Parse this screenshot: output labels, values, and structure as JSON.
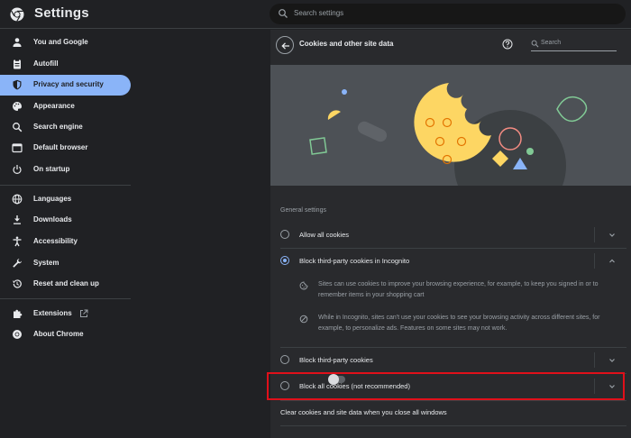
{
  "header": {
    "app_title": "Settings",
    "search_placeholder": "Search settings"
  },
  "sidebar": {
    "items": [
      {
        "label": "You and Google",
        "icon": "person-icon",
        "active": false
      },
      {
        "label": "Autofill",
        "icon": "clipboard-icon",
        "active": false
      },
      {
        "label": "Privacy and security",
        "icon": "shield-icon",
        "active": true
      },
      {
        "label": "Appearance",
        "icon": "palette-icon",
        "active": false
      },
      {
        "label": "Search engine",
        "icon": "search-icon",
        "active": false
      },
      {
        "label": "Default browser",
        "icon": "browser-window-icon",
        "active": false
      },
      {
        "label": "On startup",
        "icon": "power-icon",
        "active": false
      },
      {
        "label": "Languages",
        "icon": "globe-icon",
        "active": false
      },
      {
        "label": "Downloads",
        "icon": "download-icon",
        "active": false
      },
      {
        "label": "Accessibility",
        "icon": "accessibility-icon",
        "active": false
      },
      {
        "label": "System",
        "icon": "wrench-icon",
        "active": false
      },
      {
        "label": "Reset and clean up",
        "icon": "restore-icon",
        "active": false
      },
      {
        "label": "Extensions",
        "icon": "puzzle-icon",
        "active": false
      },
      {
        "label": "About Chrome",
        "icon": "chrome-icon",
        "active": false
      }
    ]
  },
  "panel": {
    "title": "Cookies and other site data",
    "search_placeholder": "Search",
    "section_label": "General settings",
    "options": [
      {
        "label": "Allow all cookies",
        "checked": false,
        "expanded": false
      },
      {
        "label": "Block third-party cookies in Incognito",
        "checked": true,
        "expanded": true
      },
      {
        "label": "Block third-party cookies",
        "checked": false,
        "expanded": false
      },
      {
        "label": "Block all cookies (not recommended)",
        "checked": false,
        "expanded": false
      }
    ],
    "details": [
      {
        "icon": "cookie-icon",
        "text": "Sites can use cookies to improve your browsing experience, for example, to keep you signed in or to remember items in your shopping cart"
      },
      {
        "icon": "block-icon",
        "text": "While in Incognito, sites can't use your cookies to see your browsing activity across different sites, for example, to personalize ads. Features on some sites may not work."
      }
    ],
    "clear_on_exit_label": "Clear cookies and site data when you close all windows",
    "clear_on_exit_enabled": false
  },
  "colors": {
    "accent": "#8ab4f8",
    "highlight_border": "#e0101a",
    "cookie_yellow": "#fdd663",
    "background": "#202124"
  }
}
